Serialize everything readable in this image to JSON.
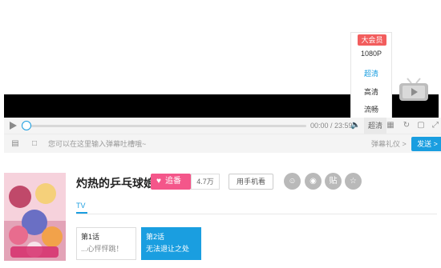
{
  "quality_menu": {
    "badge": "大会员",
    "options": [
      "1080P",
      "超清",
      "高清",
      "流畅"
    ],
    "selected": "超清"
  },
  "controls": {
    "time": "00:00 / 23:59",
    "quality_label": "超清",
    "progress": 0.0
  },
  "danmu": {
    "placeholder": "您可以在这里输入弹幕吐槽哦~",
    "gift_label": "弹幕礼仪 >",
    "send_label": "发送 >"
  },
  "show": {
    "title": "灼热的乒乓球娘",
    "subscribe_label": "追番",
    "subscribe_count": "4.7万",
    "mobile_label": "用手机看",
    "share_icons": [
      "wechat-icon",
      "weibo-icon",
      "tieba-icon",
      "favorite-icon"
    ],
    "tab": "TV"
  },
  "episodes": [
    {
      "no": "第1话",
      "name": "...心怦怦跳！",
      "active": false
    },
    {
      "no": "第2话",
      "name": "无法退让之处",
      "active": true
    }
  ],
  "colors": {
    "accent": "#1a9ee0",
    "subscribe": "#f4568a",
    "vip_badge": "#f25d5d"
  }
}
